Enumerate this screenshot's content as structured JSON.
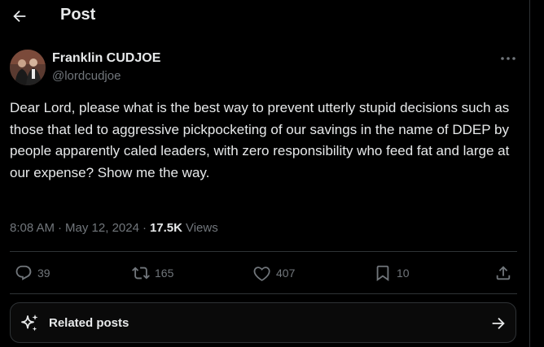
{
  "header": {
    "title": "Post"
  },
  "author": {
    "name": "Franklin CUDJOE",
    "handle": "@lordcudjoe"
  },
  "tweet": {
    "text": "Dear Lord, please what is the best way to prevent utterly stupid decisions such as those that led to aggressive pickpocketing of our savings in the name of DDEP  by people apparently caled leaders, with zero responsibility who feed fat and large at our expense? Show me the way.",
    "time": "8:08 AM",
    "separator": "·",
    "date": "May 12, 2024",
    "views_count": "17.5K",
    "views_label": "Views"
  },
  "actions": {
    "replies": "39",
    "reposts": "165",
    "likes": "407",
    "bookmarks": "10"
  },
  "related": {
    "label": "Related posts"
  },
  "icons": {
    "back": "arrow-left-icon",
    "more": "more-horizontal-icon",
    "reply": "reply-icon",
    "repost": "repost-icon",
    "like": "heart-icon",
    "bookmark": "bookmark-icon",
    "share": "share-icon",
    "sparkle": "sparkle-icon",
    "arrow_right": "arrow-right-icon"
  },
  "colors": {
    "background": "#000000",
    "text": "#e7e9ea",
    "muted": "#71767b",
    "border": "#2f3336"
  }
}
